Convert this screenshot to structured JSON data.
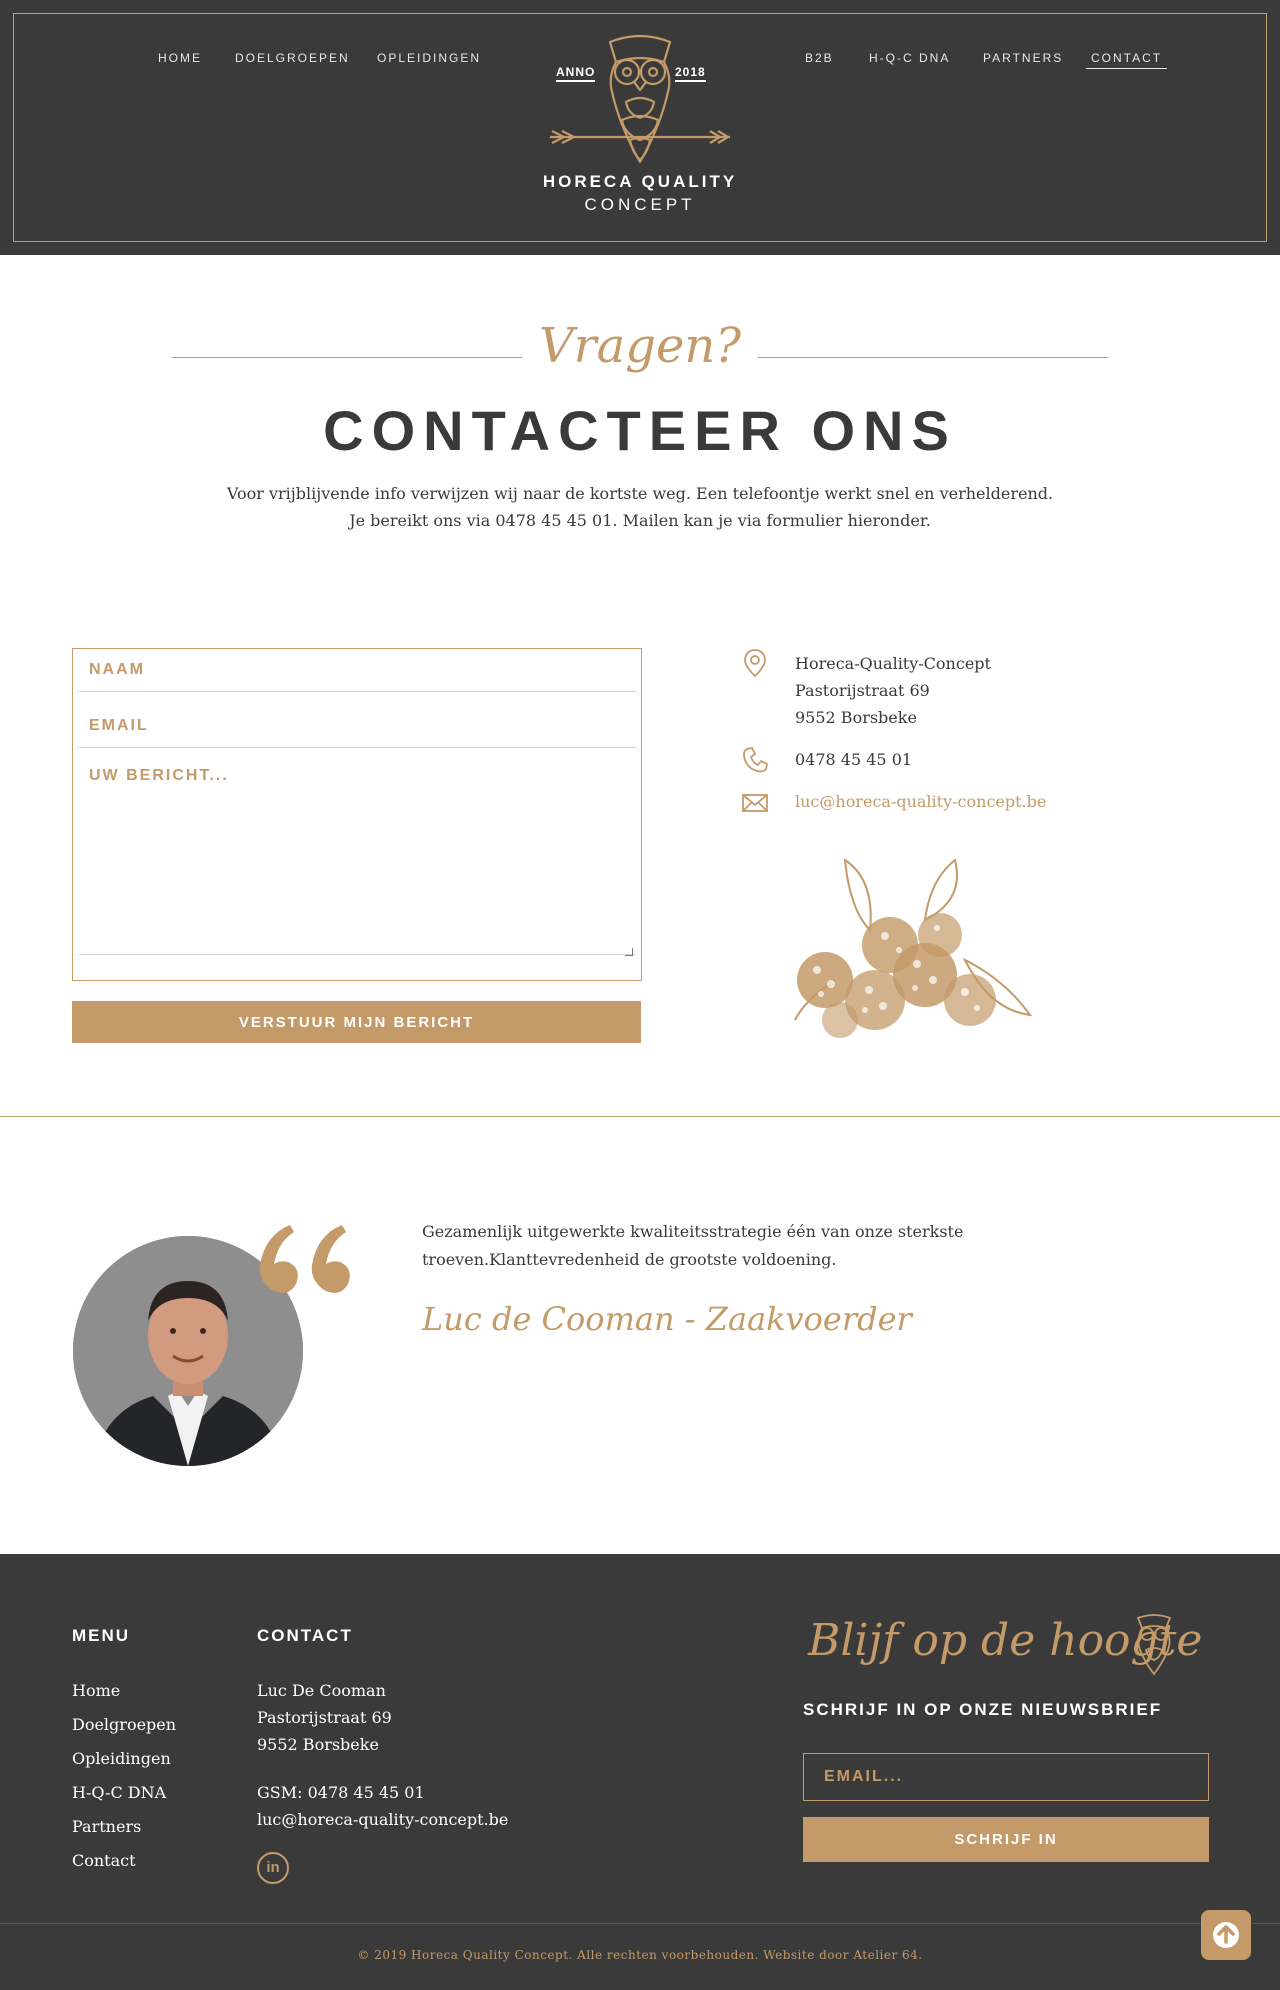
{
  "header": {
    "nav_left": [
      "HOME",
      "DOELGROEPEN",
      "OPLEIDINGEN"
    ],
    "nav_right": [
      "B2B",
      "H-Q-C DNA",
      "PARTNERS",
      "CONTACT"
    ],
    "active": "CONTACT",
    "logo": {
      "anno": "ANNO",
      "year": "2018",
      "line1": "HORECA QUALITY",
      "line2": "CONCEPT"
    }
  },
  "intro": {
    "script_title": "Vragen?",
    "title": "CONTACTEER ONS",
    "line1": "Voor vrijblijvende info verwijzen wij naar de kortste weg. Een telefoontje werkt snel en verhelderend.",
    "line2": "Je bereikt ons via 0478 45 45 01. Mailen kan je via formulier hieronder."
  },
  "form": {
    "name_placeholder": "NAAM",
    "email_placeholder": "EMAIL",
    "message_placeholder": "UW BERICHT...",
    "submit_label": "VERSTUUR MIJN BERICHT"
  },
  "contact_info": {
    "address": [
      "Horeca-Quality-Concept",
      "Pastorijstraat 69",
      "9552 Borsbeke"
    ],
    "phone": "0478 45 45 01",
    "email": "luc@horeca-quality-concept.be"
  },
  "testimonial": {
    "quote_line1": "Gezamenlijk uitgewerkte kwaliteitsstrategie één van onze sterkste",
    "quote_line2": "troeven.Klanttevredenheid de grootste voldoening.",
    "author": "Luc de Cooman - Zaakvoerder"
  },
  "footer": {
    "menu_heading": "MENU",
    "menu_items": [
      "Home",
      "Doelgroepen",
      "Opleidingen",
      "H-Q-C DNA",
      "Partners",
      "Contact"
    ],
    "contact_heading": "CONTACT",
    "contact_name": "Luc De Cooman",
    "contact_street": "Pastorijstraat 69",
    "contact_city": "9552 Borsbeke",
    "contact_gsm": "GSM: 0478 45 45 01",
    "contact_email": "luc@horeca-quality-concept.be",
    "linkedin_label": "in",
    "newsletter_script": "Blijf op de hoogte",
    "newsletter_heading": "SCHRIJF IN OP ONZE NIEUWSBRIEF",
    "newsletter_placeholder": "EMAIL...",
    "newsletter_button": "SCHRIJF IN",
    "copyright": "© 2019 Horeca Quality Concept. Alle rechten voorbehouden. Website door ",
    "credit": "Atelier 64."
  },
  "icons": {
    "pin": "map-pin-icon",
    "phone": "phone-icon",
    "mail": "mail-icon",
    "linkedin": "linkedin-icon",
    "to_top": "arrow-up-circle-icon"
  },
  "colors": {
    "accent": "#c39a68",
    "dark": "#3a3a3a",
    "white": "#ffffff"
  }
}
